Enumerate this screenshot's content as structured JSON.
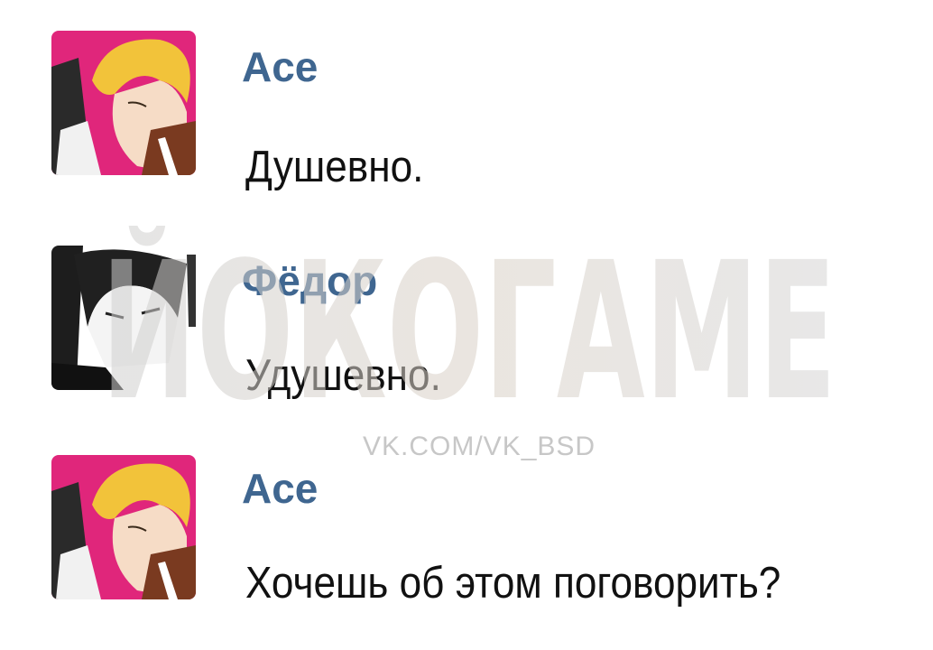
{
  "messages": [
    {
      "author": "Ace",
      "text": "Душевно.",
      "avatar_icon": "ace-avatar-icon"
    },
    {
      "author": "Фёдор",
      "text": "Удушевно.",
      "avatar_icon": "fyodor-avatar-icon"
    },
    {
      "author": "Ace",
      "text": "Хочешь об этом поговорить?",
      "avatar_icon": "ace-avatar-icon"
    }
  ],
  "watermark": {
    "logo": "ЙОКОГАМЕ",
    "url": "VK.COM/VK_BSD"
  },
  "colors": {
    "author": "#3f6690",
    "text": "#111111",
    "background": "#ffffff",
    "ace_avatar_bg": "#e0267b",
    "fyodor_avatar_bg": "#ffffff"
  }
}
